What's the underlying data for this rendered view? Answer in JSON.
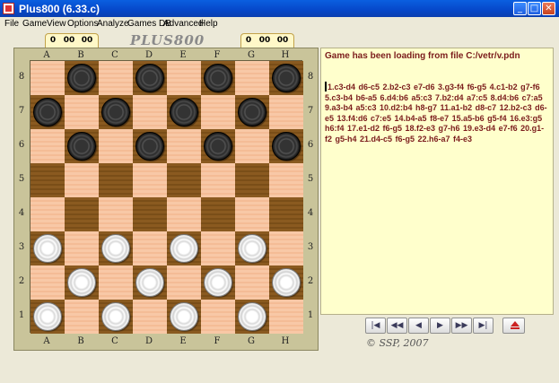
{
  "window": {
    "title": "Plus800 (6.33.c)"
  },
  "window_controls": {
    "minimize": "_",
    "maximize": "□",
    "close": "✕"
  },
  "menu": [
    "File",
    "Game",
    "View",
    "Options",
    "Analyze",
    "Games DB",
    "Advanced",
    "Help"
  ],
  "counters": {
    "left": [
      "0",
      "00",
      "00"
    ],
    "right": [
      "0",
      "00",
      "00"
    ]
  },
  "logo": "PLUS800",
  "board": {
    "files": [
      "A",
      "B",
      "C",
      "D",
      "E",
      "F",
      "G",
      "H"
    ],
    "ranks": [
      "8",
      "7",
      "6",
      "5",
      "4",
      "3",
      "2",
      "1"
    ],
    "pieces": [
      {
        "square": "b8",
        "color": "black"
      },
      {
        "square": "d8",
        "color": "black"
      },
      {
        "square": "f8",
        "color": "black"
      },
      {
        "square": "h8",
        "color": "black"
      },
      {
        "square": "a7",
        "color": "black"
      },
      {
        "square": "c7",
        "color": "black"
      },
      {
        "square": "e7",
        "color": "black"
      },
      {
        "square": "g7",
        "color": "black"
      },
      {
        "square": "b6",
        "color": "black"
      },
      {
        "square": "d6",
        "color": "black"
      },
      {
        "square": "f6",
        "color": "black"
      },
      {
        "square": "h6",
        "color": "black"
      },
      {
        "square": "a3",
        "color": "white"
      },
      {
        "square": "c3",
        "color": "white"
      },
      {
        "square": "e3",
        "color": "white"
      },
      {
        "square": "g3",
        "color": "white"
      },
      {
        "square": "b2",
        "color": "white"
      },
      {
        "square": "d2",
        "color": "white"
      },
      {
        "square": "f2",
        "color": "white"
      },
      {
        "square": "h2",
        "color": "white"
      },
      {
        "square": "a1",
        "color": "white"
      },
      {
        "square": "c1",
        "color": "white"
      },
      {
        "square": "e1",
        "color": "white"
      },
      {
        "square": "g1",
        "color": "white"
      }
    ]
  },
  "info": {
    "status": "Game has been loading from file C:/vetr/v.pdn",
    "moves": "1.c3-d4  d6-c5  2.b2-c3  e7-d6  3.g3-f4  f6-g5  4.c1-b2  g7-f6  5.c3-b4  b6-a5  6.d4:b6  a5:c3  7.b2:d4  a7:c5  8.d4:b6  c7:a5  9.a3-b4  a5:c3  10.d2:b4  h8-g7  11.a1-b2  d8-c7  12.b2-c3  d6-e5  13.f4:d6  c7:e5  14.b4-a5  f8-e7  15.a5-b6  g5-f4  16.e3:g5  h6:f4  17.e1-d2  f6-g5  18.f2-e3  g7-h6  19.e3-d4  e7-f6  20.g1-f2  g5-h4  21.d4-c5  f6-g5  22.h6-a7  f4-e3"
  },
  "nav_buttons": [
    {
      "id": "first",
      "glyph": "|◀"
    },
    {
      "id": "prev-fast",
      "glyph": "◀◀"
    },
    {
      "id": "prev",
      "glyph": "◀"
    },
    {
      "id": "next",
      "glyph": "▶"
    },
    {
      "id": "next-fast",
      "glyph": "▶▶"
    },
    {
      "id": "last",
      "glyph": "▶|"
    }
  ],
  "eject_icon": "eject-icon",
  "copyright": "© SSP, 2007",
  "colors": {
    "status_text": "#7b1c1c",
    "panel_bg": "#ffffcc",
    "light_square": "#f8c8a6",
    "dark_square": "#8a5a20"
  }
}
